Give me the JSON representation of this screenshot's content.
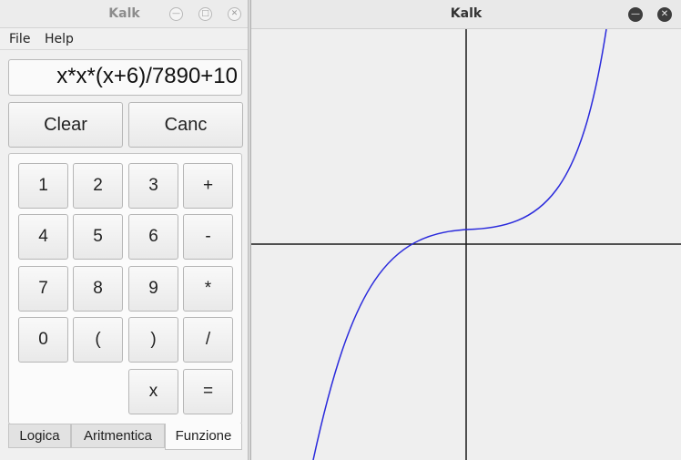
{
  "calc_window": {
    "title": "Kalk",
    "menu": [
      "File",
      "Help"
    ],
    "display_value": "x*x*(x+6)/7890+10",
    "clear_label": "Clear",
    "canc_label": "Canc",
    "keys": [
      "1",
      "2",
      "3",
      "+",
      "4",
      "5",
      "6",
      "-",
      "7",
      "8",
      "9",
      "*",
      "0",
      "(",
      ")",
      "/",
      "x",
      "="
    ],
    "tabs": [
      "Logica",
      "Aritmentica",
      "Funzione"
    ],
    "active_tab": "Funzione",
    "control_icons": [
      "minimize-icon",
      "maximize-icon",
      "close-icon"
    ]
  },
  "plot_window": {
    "title": "Kalk",
    "control_icons": [
      "minimize-icon",
      "close-icon"
    ],
    "curve_color": "#2a2adc",
    "axis_color": "#1a1a1a",
    "function": "x*x*(x+6)/7890+10"
  }
}
